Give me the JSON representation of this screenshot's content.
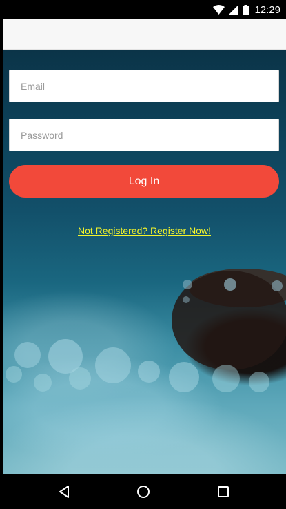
{
  "status_bar": {
    "time": "12:29",
    "icons": [
      "wifi-icon",
      "signal-icon",
      "battery-icon"
    ]
  },
  "login_form": {
    "email_placeholder": "Email",
    "password_placeholder": "Password",
    "login_label": "Log In",
    "register_link": "Not Registered? Register Now!"
  },
  "nav_bar": {
    "icons": [
      "back-icon",
      "home-icon",
      "recents-icon"
    ]
  },
  "colors": {
    "accent": "#f2493a",
    "link": "#f4f42a"
  }
}
